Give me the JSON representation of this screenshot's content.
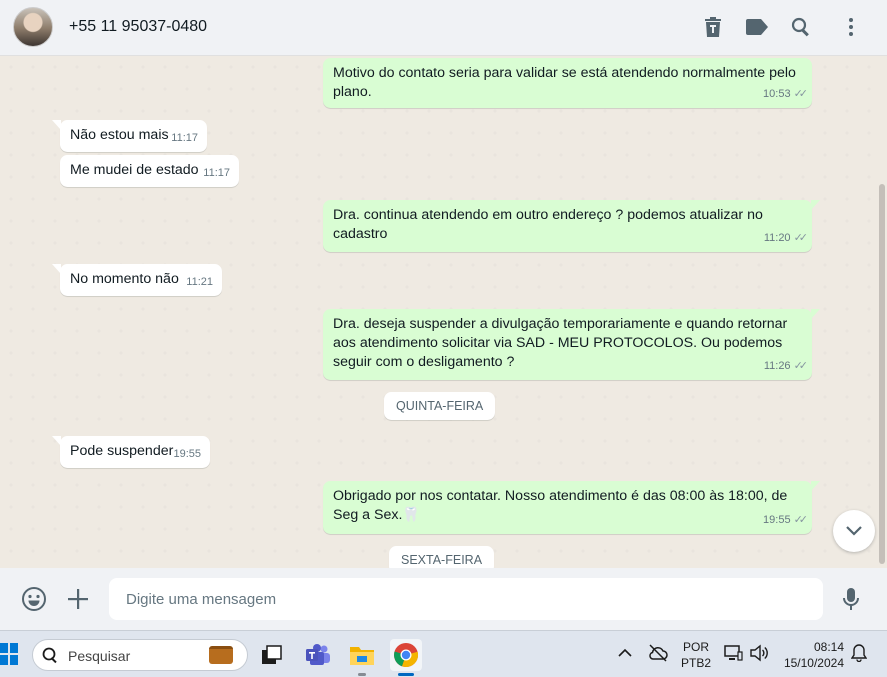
{
  "header": {
    "contact": "+55 11 95037-0480",
    "icons": [
      "delete-icon",
      "label-icon",
      "search-icon",
      "menu-icon"
    ]
  },
  "messages": [
    {
      "dir": "out",
      "text": "Motivo do contato seria para validar se está atendendo normalmente pelo plano.",
      "time": "10:53"
    },
    {
      "dir": "in",
      "text": "Não estou mais",
      "time": "11:17"
    },
    {
      "dir": "in",
      "text": "Me mudei de estado",
      "time": "11:17"
    },
    {
      "dir": "out",
      "text": "Dra. continua atendendo em outro endereço ? podemos atualizar no cadastro",
      "time": "11:20"
    },
    {
      "dir": "in",
      "text": "No momento não",
      "time": "11:21"
    },
    {
      "dir": "out",
      "text": "Dra. deseja suspender a divulgação temporariamente e quando retornar aos atendimento solicitar via SAD - MEU PROTOCOLOS. Ou podemos seguir com o desligamento ?",
      "time": "11:26"
    },
    {
      "dir": "in",
      "text": "Pode suspender",
      "time": "19:55"
    },
    {
      "dir": "out",
      "text": "Obrigado por nos contatar. Nosso atendimento é das 08:00 às 18:00, de Seg a Sex.🦷",
      "time": "19:55"
    }
  ],
  "day_separators": [
    "QUINTA-FEIRA",
    "SEXTA-FEIRA"
  ],
  "ticks": "✓✓",
  "composer": {
    "placeholder": "Digite uma mensagem"
  },
  "taskbar": {
    "search_label": "Pesquisar",
    "lang_top": "POR",
    "lang_bottom": "PTB2",
    "time": "08:14",
    "date": "15/10/2024"
  },
  "colors": {
    "outgoing": "#d9fdd3",
    "incoming": "#ffffff",
    "background": "#efeae2"
  }
}
